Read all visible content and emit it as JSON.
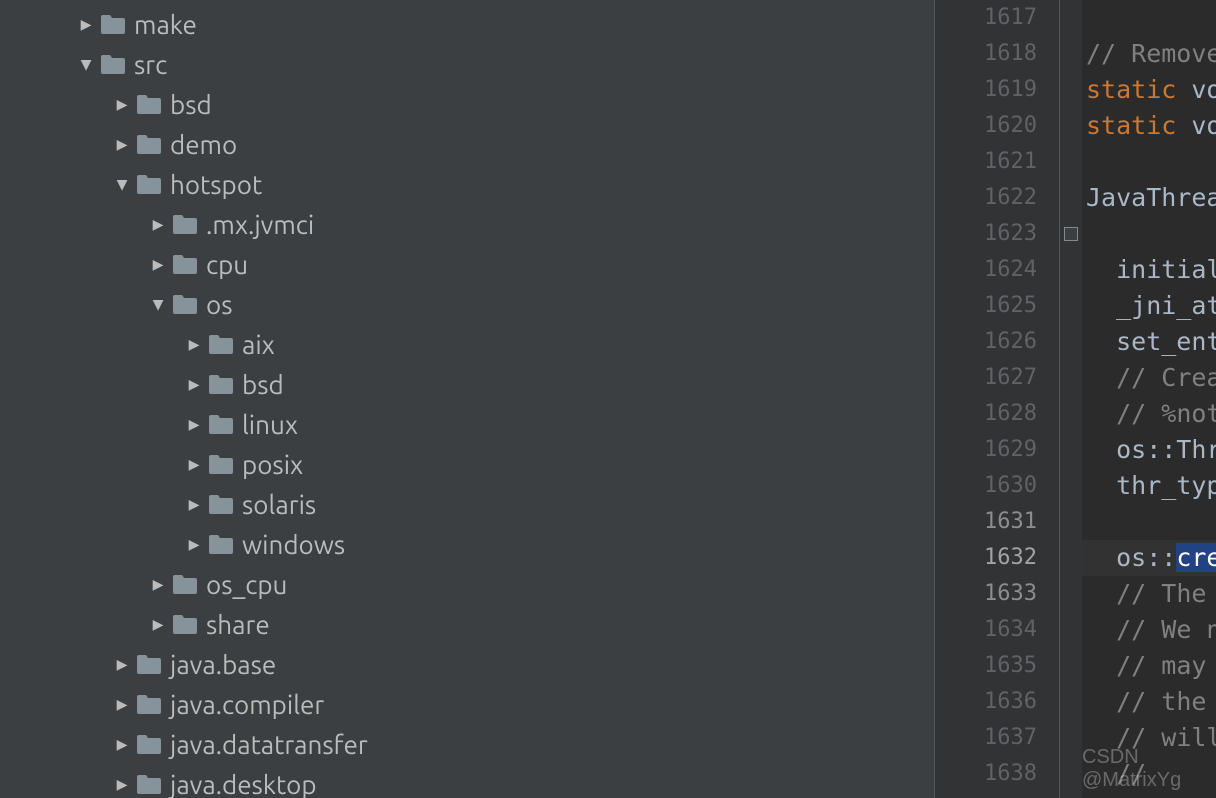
{
  "tree": [
    {
      "name": "make",
      "depth": 2,
      "expanded": false
    },
    {
      "name": "src",
      "depth": 2,
      "expanded": true
    },
    {
      "name": "bsd",
      "depth": 3,
      "expanded": false
    },
    {
      "name": "demo",
      "depth": 3,
      "expanded": false
    },
    {
      "name": "hotspot",
      "depth": 3,
      "expanded": true
    },
    {
      "name": ".mx.jvmci",
      "depth": 4,
      "expanded": false
    },
    {
      "name": "cpu",
      "depth": 4,
      "expanded": false
    },
    {
      "name": "os",
      "depth": 4,
      "expanded": true
    },
    {
      "name": "aix",
      "depth": 5,
      "expanded": false
    },
    {
      "name": "bsd",
      "depth": 5,
      "expanded": false
    },
    {
      "name": "linux",
      "depth": 5,
      "expanded": false
    },
    {
      "name": "posix",
      "depth": 5,
      "expanded": false
    },
    {
      "name": "solaris",
      "depth": 5,
      "expanded": false
    },
    {
      "name": "windows",
      "depth": 5,
      "expanded": false
    },
    {
      "name": "os_cpu",
      "depth": 4,
      "expanded": false
    },
    {
      "name": "share",
      "depth": 4,
      "expanded": false
    },
    {
      "name": "java.base",
      "depth": 3,
      "expanded": false
    },
    {
      "name": "java.compiler",
      "depth": 3,
      "expanded": false
    },
    {
      "name": "java.datatransfer",
      "depth": 3,
      "expanded": false
    },
    {
      "name": "java.desktop",
      "depth": 3,
      "expanded": false
    }
  ],
  "line_start": 1617,
  "line_count": 22,
  "current_line": 1632,
  "code": {
    "1617": {
      "text": ""
    },
    "1618": {
      "indent": 0,
      "comment": "// Remove "
    },
    "1619": {
      "indent": 0,
      "kw": "static ",
      "rest": "voi"
    },
    "1620": {
      "indent": 0,
      "kw": "static ",
      "rest": "voi"
    },
    "1621": {
      "text": ""
    },
    "1622": {
      "indent": 0,
      "rest": "JavaThread"
    },
    "1623": {
      "text": ""
    },
    "1624": {
      "indent": 1,
      "rest": "initiali"
    },
    "1625": {
      "indent": 1,
      "rest": "_jni_att"
    },
    "1626": {
      "indent": 1,
      "rest": "set_entr"
    },
    "1627": {
      "indent": 1,
      "comment": "// Creat"
    },
    "1628": {
      "indent": 1,
      "comment": "// %note"
    },
    "1629": {
      "indent": 1,
      "rest": "os::Thre"
    },
    "1630": {
      "indent": 1,
      "rest": "thr_type"
    },
    "1631": {
      "text": ""
    },
    "1632": {
      "indent": 1,
      "rest_pre": "os::",
      "sel": "crea"
    },
    "1633": {
      "indent": 1,
      "comment": "// The "
    },
    "1634": {
      "indent": 1,
      "comment": "// We ne"
    },
    "1635": {
      "indent": 1,
      "comment": "// may h"
    },
    "1636": {
      "indent": 1,
      "comment": "// the e"
    },
    "1637": {
      "indent": 1,
      "comment": "// will "
    },
    "1638": {
      "indent": 1,
      "comment": "// "
    }
  },
  "watermark": "CSDN @MatrixYg"
}
